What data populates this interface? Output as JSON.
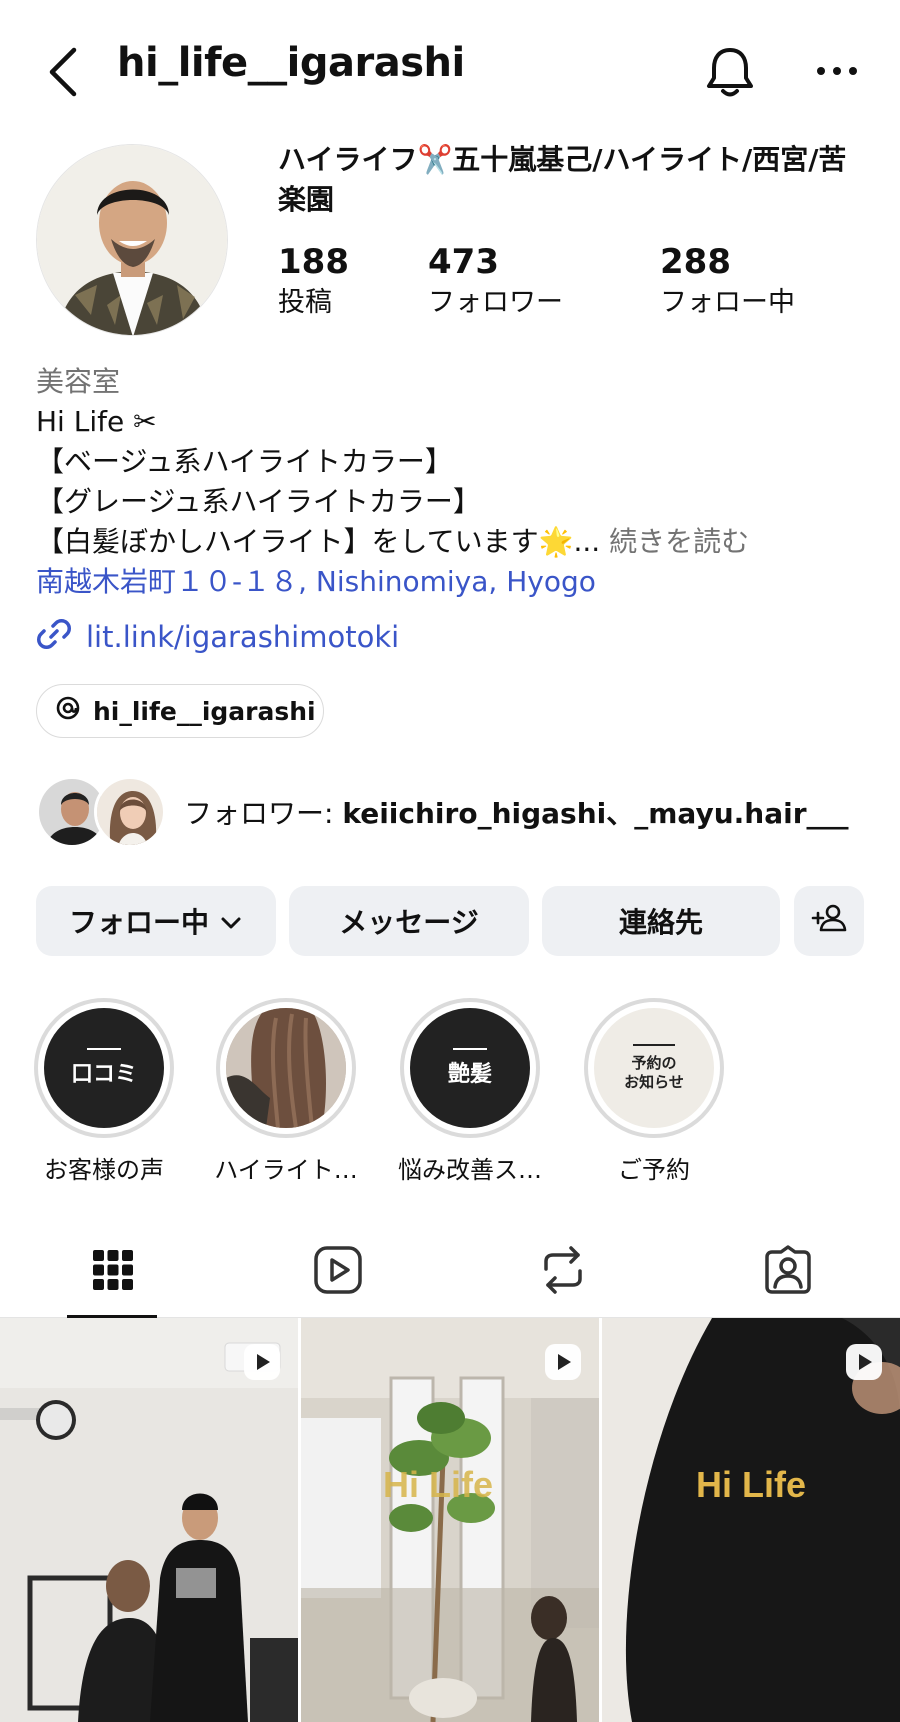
{
  "header": {
    "username": "hi_life__igarashi"
  },
  "profile": {
    "display_name": "ハイライフ✂️五十嵐基己/ハイライト/西宮/苦楽園",
    "stats": [
      {
        "count": "188",
        "label": "投稿"
      },
      {
        "count": "473",
        "label": "フォロワー"
      },
      {
        "count": "288",
        "label": "フォロー中"
      }
    ],
    "category": "美容室",
    "bio_lines": [
      "Hi Life ✂",
      "【ベージュ系ハイライトカラー】",
      "【グレージュ系ハイライトカラー】",
      "【白髪ぼかしハイライト】をしています🌟..."
    ],
    "read_more": " 続きを読む",
    "location": "南越木岩町１０-１８, Nishinomiya, Hyogo",
    "link": "lit.link/igarashimotoki",
    "threads_handle": "hi_life__igarashi",
    "followed_by_prefix": "フォロワー: ",
    "followed_by_names": "keiichiro_higashi、_mayu.hair___"
  },
  "actions": {
    "following": "フォロー中",
    "message": "メッセージ",
    "contact": "連絡先"
  },
  "highlights": [
    {
      "label": "お客様の声",
      "cover_text": "口コミ"
    },
    {
      "label": "ハイライト…",
      "cover_text": ""
    },
    {
      "label": "悩み改善ス…",
      "cover_text": "艶髪"
    },
    {
      "label": "ご予約",
      "cover_text": "予約の\nお知らせ"
    }
  ],
  "grid": {
    "posts": [
      {
        "overlay_text": ""
      },
      {
        "overlay_text": "Hi Life"
      },
      {
        "overlay_text": "Hi Life"
      }
    ]
  },
  "colors": {
    "link_blue": "#3a55c8",
    "muted_gray": "#737373",
    "button_bg": "#eef0f3"
  }
}
